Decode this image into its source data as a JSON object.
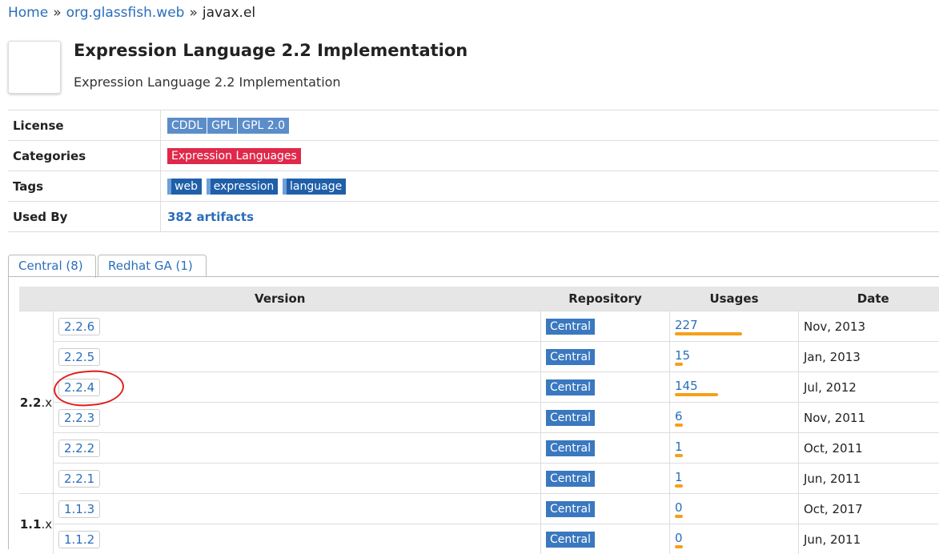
{
  "breadcrumb": {
    "home": "Home",
    "group": "org.glassfish.web",
    "artifact": "javax.el",
    "sep": "»"
  },
  "header": {
    "title": "Expression Language 2.2 Implementation",
    "subtitle": "Expression Language 2.2 Implementation"
  },
  "info": {
    "license_label": "License",
    "licenses": [
      "CDDL",
      "GPL",
      "GPL 2.0"
    ],
    "categories_label": "Categories",
    "categories": [
      "Expression Languages"
    ],
    "tags_label": "Tags",
    "tags": [
      "web",
      "expression",
      "language"
    ],
    "used_by_label": "Used By",
    "used_by": "382 artifacts"
  },
  "tabs": [
    {
      "label": "Central (8)"
    },
    {
      "label": "Redhat GA (1)"
    }
  ],
  "table": {
    "headers": {
      "version": "Version",
      "repository": "Repository",
      "usages": "Usages",
      "date": "Date"
    },
    "groups": [
      {
        "major": "2.2",
        "suffix": ".x"
      },
      {
        "major": "1.1",
        "suffix": ".x"
      }
    ],
    "rows": [
      {
        "version": "2.2.6",
        "repo": "Central",
        "usages": "227",
        "usage_value": 227,
        "date": "Nov, 2013"
      },
      {
        "version": "2.2.5",
        "repo": "Central",
        "usages": "15",
        "usage_value": 15,
        "date": "Jan, 2013"
      },
      {
        "version": "2.2.4",
        "repo": "Central",
        "usages": "145",
        "usage_value": 145,
        "date": "Jul, 2012"
      },
      {
        "version": "2.2.3",
        "repo": "Central",
        "usages": "6",
        "usage_value": 6,
        "date": "Nov, 2011"
      },
      {
        "version": "2.2.2",
        "repo": "Central",
        "usages": "1",
        "usage_value": 1,
        "date": "Oct, 2011"
      },
      {
        "version": "2.2.1",
        "repo": "Central",
        "usages": "1",
        "usage_value": 1,
        "date": "Jun, 2011"
      },
      {
        "version": "1.1.3",
        "repo": "Central",
        "usages": "0",
        "usage_value": 0,
        "date": "Oct, 2017"
      },
      {
        "version": "1.1.2",
        "repo": "Central",
        "usages": "0",
        "usage_value": 0,
        "date": "Jun, 2011"
      }
    ]
  },
  "colors": {
    "link": "#2a6ebb",
    "license_badge": "#5b8dc9",
    "category_badge": "#e0284a",
    "tag_badge": "#1f5fa9",
    "usage_bar": "#f5a01a",
    "highlight": "#e02020"
  }
}
